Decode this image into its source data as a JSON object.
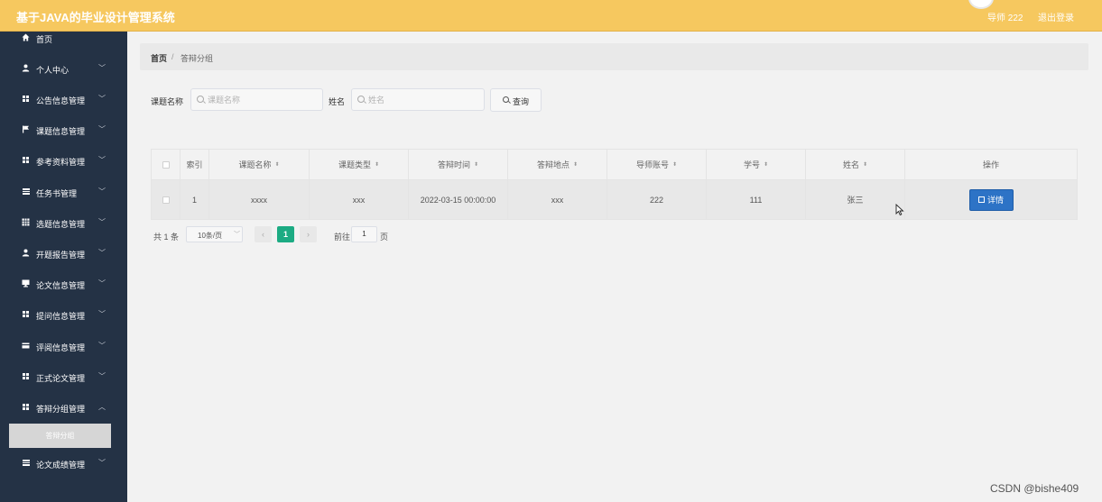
{
  "header": {
    "title": "基于JAVA的毕业设计管理系统",
    "user": "导师 222",
    "logout": "退出登录"
  },
  "sidebar": {
    "items": [
      {
        "label": "首页",
        "icon": "home-icon"
      },
      {
        "label": "个人中心",
        "icon": "user-icon"
      },
      {
        "label": "公告信息管理",
        "icon": "grid-icon"
      },
      {
        "label": "课题信息管理",
        "icon": "flag-icon"
      },
      {
        "label": "参考资料管理",
        "icon": "grid-icon"
      },
      {
        "label": "任务书管理",
        "icon": "list-icon"
      },
      {
        "label": "选题信息管理",
        "icon": "table-icon"
      },
      {
        "label": "开题报告管理",
        "icon": "user-icon"
      },
      {
        "label": "论文信息管理",
        "icon": "monitor-icon"
      },
      {
        "label": "提问信息管理",
        "icon": "grid-icon"
      },
      {
        "label": "评阅信息管理",
        "icon": "card-icon"
      },
      {
        "label": "正式论文管理",
        "icon": "grid-icon"
      },
      {
        "label": "答辩分组管理",
        "icon": "grid-icon"
      },
      {
        "label": "论文成绩管理",
        "icon": "list-icon"
      }
    ],
    "active_sub": "答辩分组"
  },
  "breadcrumb": {
    "home": "首页",
    "separator": "/",
    "current": "答辩分组"
  },
  "search": {
    "title_label": "课题名称",
    "title_placeholder": "课题名称",
    "name_label": "姓名",
    "name_placeholder": "姓名",
    "query": "查询"
  },
  "table": {
    "columns": [
      "索引",
      "课题名称",
      "课题类型",
      "答辩时间",
      "答辩地点",
      "导师账号",
      "学号",
      "姓名",
      "操作"
    ],
    "rows": [
      {
        "index": "1",
        "title": "xxxx",
        "type": "xxx",
        "time": "2022-03-15 00:00:00",
        "place": "xxx",
        "tutor": "222",
        "student_no": "111",
        "name": "张三",
        "action": "详情"
      }
    ]
  },
  "pagination": {
    "total": "共 1 条",
    "page_size": "10条/页",
    "prev": "‹",
    "current": "1",
    "next": "›",
    "goto": "前往",
    "goto_value": "1",
    "page_unit": "页"
  },
  "watermark": "CSDN @bishe409",
  "colors": {
    "header": "#f6c85f",
    "sidebar": "#243245",
    "primary": "#2d73c6",
    "pager_active": "#1cab83"
  }
}
